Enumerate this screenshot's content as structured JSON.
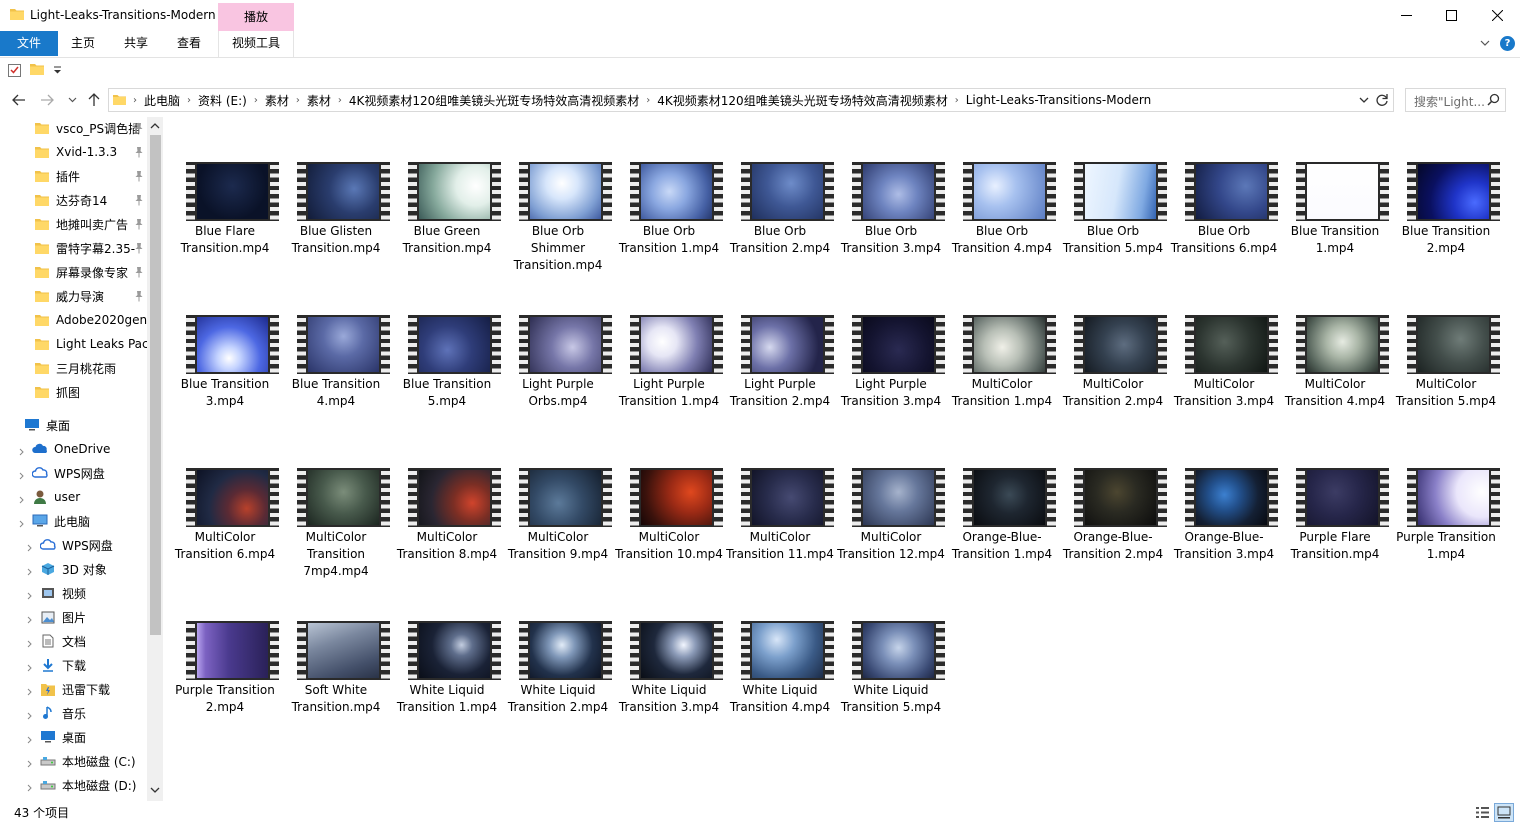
{
  "window": {
    "title": "Light-Leaks-Transitions-Modern",
    "contextual_tab": "播放"
  },
  "ribbon": {
    "file": "文件",
    "tabs": [
      "主页",
      "共享",
      "查看"
    ],
    "video_tools": "视频工具"
  },
  "address": {
    "crumbs": [
      "此电脑",
      "资料 (E:)",
      "素材",
      "素材",
      "4K视频素材120组唯美镜头光斑专场特效高清视频素材",
      "4K视频素材120组唯美镜头光斑专场特效高清视频素材",
      "Light-Leaks-Transitions-Modern"
    ]
  },
  "search": {
    "placeholder": "搜索\"Light..."
  },
  "nav": {
    "quick_access": [
      "vsco_PS调色插",
      "Xvid-1.3.3",
      "插件",
      "达芬奇14",
      "地摊叫卖广告",
      "雷特字幕2.35-",
      "屏幕录像专家",
      "威力导演",
      "Adobe2020gen",
      "Light Leaks Pack",
      "三月桃花雨",
      "抓图"
    ],
    "desktop": "桌面",
    "onedrive": "OneDrive",
    "wps_cloud": "WPS网盘",
    "user": "user",
    "this_pc": "此电脑",
    "pc_children": [
      "WPS网盘",
      "3D 对象",
      "视频",
      "图片",
      "文档",
      "下载",
      "迅雷下载",
      "音乐",
      "桌面",
      "本地磁盘 (C:)",
      "本地磁盘 (D:)"
    ]
  },
  "files": [
    {
      "name": "Blue Flare Transition.mp4",
      "bg": "radial-gradient(circle at 50% 40%, #1c2a4e 0%, #0a1228 70%)"
    },
    {
      "name": "Blue Glisten Transition.mp4",
      "bg": "radial-gradient(circle at 65% 45%, #5a78b6 0%, #2a3d6e 45%, #121c38 100%)"
    },
    {
      "name": "Blue Green Transition.mp4",
      "bg": "radial-gradient(circle at 80% 40%, #ffffff 0%, #e2efe9 30%, #86a99c 65%, #3b5a57 100%)"
    },
    {
      "name": "Blue Orb Shimmer Transition.mp4",
      "bg": "radial-gradient(circle at 45% 35%, #ffffff 0%, #d7e6fb 30%, #7f9fd3 70%, #3e5aa0 100%)"
    },
    {
      "name": "Blue Orb Transition 1.mp4",
      "bg": "radial-gradient(circle at 40% 50%, #c9d9f7 0%, #8aa7e0 35%, #4560a4 75%, #26386c 100%)"
    },
    {
      "name": "Blue Orb Transition 2.mp4",
      "bg": "radial-gradient(circle at 55% 35%, #6e8cc9 0%, #3f5895 45%, #1f2f5c 100%)"
    },
    {
      "name": "Blue Orb Transition 3.mp4",
      "bg": "radial-gradient(circle at 50% 55%, #aebde6 0%, #6e84c0 40%, #2e3b6e 100%)"
    },
    {
      "name": "Blue Orb Transition 4.mp4",
      "bg": "radial-gradient(circle at 30% 40%, #e8f0ff 0%, #a7c1ef 35%, #5b7cc2 100%)"
    },
    {
      "name": "Blue Orb Transition 5.mp4",
      "bg": "linear-gradient(100deg, #eef6ff 0%, #d6e7fb 45%, #7fa9e2 80%, #3364b3 100%)"
    },
    {
      "name": "Blue Orb Transitions 6.mp4",
      "bg": "radial-gradient(circle at 70% 40%, #5c78b8 0%, #33478a 45%, #121c40 100%)"
    },
    {
      "name": "Blue Transition 1.mp4",
      "bg": "linear-gradient(#ffffff, #fbfbff)"
    },
    {
      "name": "Blue Transition 2.mp4",
      "bg": "radial-gradient(circle at 80% 70%, #4a6bff 0%, #1f34c8 30%, #0a1060 65%, #050828 100%)"
    },
    {
      "name": "Blue Transition 3.mp4",
      "bg": "radial-gradient(circle at 45% 75%, #ffffff 0%, #c4d3ff 20%, #4d68e3 55%, #1d2a8c 100%)"
    },
    {
      "name": "Blue Transition 4.mp4",
      "bg": "radial-gradient(circle at 50% 35%, #9aa9d9 0%, #5b6aa6 40%, #2a3468 100%)"
    },
    {
      "name": "Blue Transition 5.mp4",
      "bg": "radial-gradient(circle at 40% 60%, #5e72b8 0%, #2f3d79 45%, #151e45 100%)"
    },
    {
      "name": "Light Purple Orbs.mp4",
      "bg": "radial-gradient(circle at 60% 55%, #c8c8e6 0%, #7676a8 40%, #2e2e52 100%)"
    },
    {
      "name": "Light Purple Transition 1.mp4",
      "bg": "radial-gradient(circle at 30% 45%, #ffffff 0%, #e6e6f5 25%, #7f7fb2 60%, #2c2c54 100%)"
    },
    {
      "name": "Light Purple Transition 2.mp4",
      "bg": "radial-gradient(circle at 25% 55%, #d6d9ef 0%, #6c70a7 35%, #23244a 80%)"
    },
    {
      "name": "Light Purple Transition 3.mp4",
      "bg": "radial-gradient(circle at 50% 60%, #2a2a52 0%, #141430 60%, #0a0a1c 100%)"
    },
    {
      "name": "MultiColor Transition 1.mp4",
      "bg": "radial-gradient(circle at 40% 55%, #f0f0e8 0%, #b8bfb6 35%, #5f6a66 75%, #2a3230 100%)"
    },
    {
      "name": "MultiColor Transition 2.mp4",
      "bg": "radial-gradient(circle at 55% 50%, #5e6d80 0%, #344150 45%, #151b22 100%)"
    },
    {
      "name": "MultiColor Transition 3.mp4",
      "bg": "radial-gradient(circle at 40% 45%, #556059 0%, #2c3530 50%, #101613 100%)"
    },
    {
      "name": "MultiColor Transition 4.mp4",
      "bg": "radial-gradient(circle at 50% 45%, #e6ebe2 0%, #a9b5a6 35%, #55635a 75%, #28302c 100%)"
    },
    {
      "name": "MultiColor Transition 5.mp4",
      "bg": "radial-gradient(circle at 60% 40%, #6f7c78 0%, #434e4b 45%, #1c2322 100%)"
    },
    {
      "name": "MultiColor Transition 6.mp4",
      "bg": "radial-gradient(circle at 70% 70%, #b8412b 0%, #5b2a34 30%, #202a44 60%, #0d1224 100%)"
    },
    {
      "name": "MultiColor Transition 7mp4.mp4",
      "bg": "radial-gradient(circle at 50% 40%, #7b8d7a 0%, #485a4c 45%, #1c2620 100%)"
    },
    {
      "name": "MultiColor Transition 8.mp4",
      "bg": "radial-gradient(circle at 75% 60%, #d0442c 0%, #7b2e24 30%, #2a2632 65%, #121418 100%)"
    },
    {
      "name": "MultiColor Transition 9.mp4",
      "bg": "radial-gradient(circle at 40% 60%, #5c7a9a 0%, #334a66 45%, #141e2c 100%)"
    },
    {
      "name": "MultiColor Transition 10.mp4",
      "bg": "radial-gradient(circle at 70% 40%, #e0481e 0%, #9b2a15 35%, #3b120c 75%, #150606 100%)"
    },
    {
      "name": "MultiColor Transition 11.mp4",
      "bg": "radial-gradient(circle at 55% 50%, #464a72 0%, #282c4c 50%, #121428 100%)"
    },
    {
      "name": "MultiColor Transition 12.mp4",
      "bg": "radial-gradient(circle at 50% 40%, #a6b3cc 0%, #66779b 40%, #2c3652 100%)"
    },
    {
      "name": "Orange-Blue-Transition 1.mp4",
      "bg": "radial-gradient(circle at 50% 45%, #3b4a56 0%, #1e2630 40%, #0a0c10 100%)"
    },
    {
      "name": "Orange-Blue-Transition 2.mp4",
      "bg": "radial-gradient(circle at 45% 40%, #4c4630 0%, #2a2a22 40%, #0c0c0c 100%)"
    },
    {
      "name": "Orange-Blue-Transition 3.mp4",
      "bg": "radial-gradient(circle at 40% 45%, #3c80d0 0%, #22508c 30%, #142034 65%, #080a10 100%)"
    },
    {
      "name": "Purple Flare Transition.mp4",
      "bg": "radial-gradient(circle at 40% 40%, #3c3c64 0%, #26264a 45%, #131328 100%)"
    },
    {
      "name": "Purple Transition 1.mp4",
      "bg": "radial-gradient(circle at 90% 40%, #ffffff 0%, #eae6fb 35%, #8a80c8 65%, #332c6c 100%)"
    },
    {
      "name": "Purple Transition 2.mp4",
      "bg": "linear-gradient(90deg, #b7a3ee 0%, #7c62c2 12%, #4a3a8e 45%, #2a2158 100%)"
    },
    {
      "name": "Soft White Transition.mp4",
      "bg": "linear-gradient(160deg, #b9c4d4 0%, #7a879e 35%, #44506a 75%, #2a3348 100%)"
    },
    {
      "name": "White Liquid Transition 1.mp4",
      "bg": "radial-gradient(circle at 60% 40%, #c3cde0 0%, #5f6e8c 20%, #1a2236 55%, #0a0e18 100%)"
    },
    {
      "name": "White Liquid Transition 2.mp4",
      "bg": "radial-gradient(circle at 45% 40%, #e2ecf8 0%, #7f97b8 25%, #22324c 60%, #0c1220 100%)"
    },
    {
      "name": "White Liquid Transition 3.mp4",
      "bg": "radial-gradient(circle at 60% 40%, #f2f6ff 0%, #8c9bb8 22%, #1e283c 55%, #0a0e16 100%)"
    },
    {
      "name": "White Liquid Transition 4.mp4",
      "bg": "radial-gradient(circle at 35% 30%, #d8e6f8 0%, #7ca0cc 30%, #3a5a86 65%, #1c2c48 100%)"
    },
    {
      "name": "White Liquid Transition 5.mp4",
      "bg": "radial-gradient(circle at 50% 45%, #c6d4ea 0%, #7a8fb8 35%, #3a4a74 75%, #1e2846 100%)"
    }
  ],
  "status": {
    "count": "43 个项目"
  },
  "colors": {
    "accent": "#1979ca",
    "contextual_tab": "#f9c5e1"
  }
}
